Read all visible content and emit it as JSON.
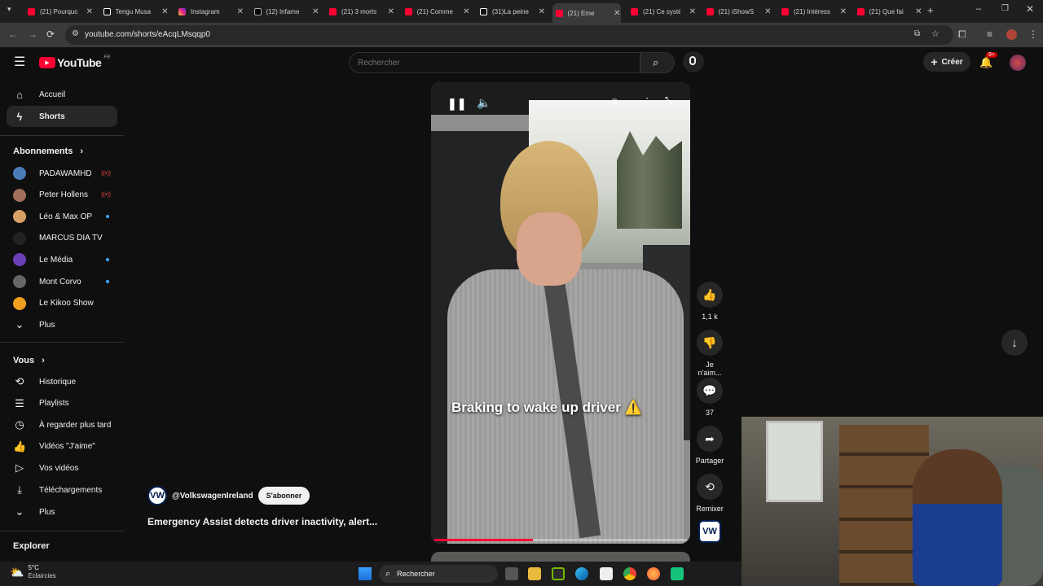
{
  "browser": {
    "tabs": [
      {
        "label": "(21) Pourquoi",
        "icon": "youtube-icon"
      },
      {
        "label": "Tengu Musa",
        "icon": "tiktok-icon"
      },
      {
        "label": "Instagram",
        "icon": "instagram-icon"
      },
      {
        "label": "(12) Infame",
        "icon": "x-icon"
      },
      {
        "label": "(21) 3 morts",
        "icon": "youtube-icon"
      },
      {
        "label": "(21) Comme",
        "icon": "youtube-icon"
      },
      {
        "label": "(31)La peine",
        "icon": "tiktok-icon"
      },
      {
        "label": "(21) Eme",
        "icon": "youtube-icon",
        "active": true
      },
      {
        "label": "(21) Ce systè",
        "icon": "youtube-icon"
      },
      {
        "label": "(21) iShowS",
        "icon": "youtube-icon"
      },
      {
        "label": "(21) Intéress",
        "icon": "youtube-icon"
      },
      {
        "label": "(21) Que fai",
        "icon": "youtube-icon"
      }
    ],
    "url": "youtube.com/shorts/eAcqLMsqqp0"
  },
  "header": {
    "logo": "YouTube",
    "region": "FR",
    "search_placeholder": "Rechercher",
    "create_label": "Créer",
    "notif_count": "9+"
  },
  "sidebar": {
    "main": [
      {
        "label": "Accueil",
        "icon": "home-icon"
      },
      {
        "label": "Shorts",
        "icon": "shorts-icon",
        "active": true
      }
    ],
    "subs_title": "Abonnements",
    "subs": [
      {
        "label": "PADAWAMHD",
        "color": "#4a7cb8",
        "status": "live"
      },
      {
        "label": "Peter Hollens",
        "color": "#a0705a",
        "status": "live"
      },
      {
        "label": "Léo & Max OP",
        "color": "#d9a066",
        "status": "new"
      },
      {
        "label": "MARCUS DIA TV",
        "color": "#222222",
        "status": ""
      },
      {
        "label": "Le Média",
        "color": "#6a3fb5",
        "status": "new"
      },
      {
        "label": "Mont Corvo",
        "color": "#666666",
        "status": "new"
      },
      {
        "label": "Le Kikoo Show",
        "color": "#f0a020",
        "status": ""
      }
    ],
    "subs_more": "Plus",
    "you_title": "Vous",
    "you": [
      {
        "label": "Historique",
        "icon": "history-icon"
      },
      {
        "label": "Playlists",
        "icon": "playlist-icon"
      },
      {
        "label": "À regarder plus tard",
        "icon": "clock-icon"
      },
      {
        "label": "Vidéos \"J'aime\"",
        "icon": "thumb-up-icon"
      },
      {
        "label": "Vos vidéos",
        "icon": "video-icon"
      },
      {
        "label": "Téléchargements",
        "icon": "download-icon"
      }
    ],
    "you_more": "Plus",
    "explore_title": "Explorer"
  },
  "short": {
    "caption": "Braking to wake up driver ⚠️",
    "progress": 0.39,
    "channel": "@VolkswagenIreland",
    "subscribe_label": "S'abonner",
    "title": "Emergency Assist detects driver inactivity, alert..."
  },
  "actions": {
    "likes": "1,1 k",
    "dislike": "Je n'aim...",
    "comments": "37",
    "share": "Partager",
    "remix": "Remixer"
  },
  "taskbar": {
    "weather_temp": "5°C",
    "weather_desc": "Eclaircies",
    "search_label": "Rechercher"
  },
  "colors": {
    "accent": "#ff0033",
    "background": "#0f0f0f"
  }
}
